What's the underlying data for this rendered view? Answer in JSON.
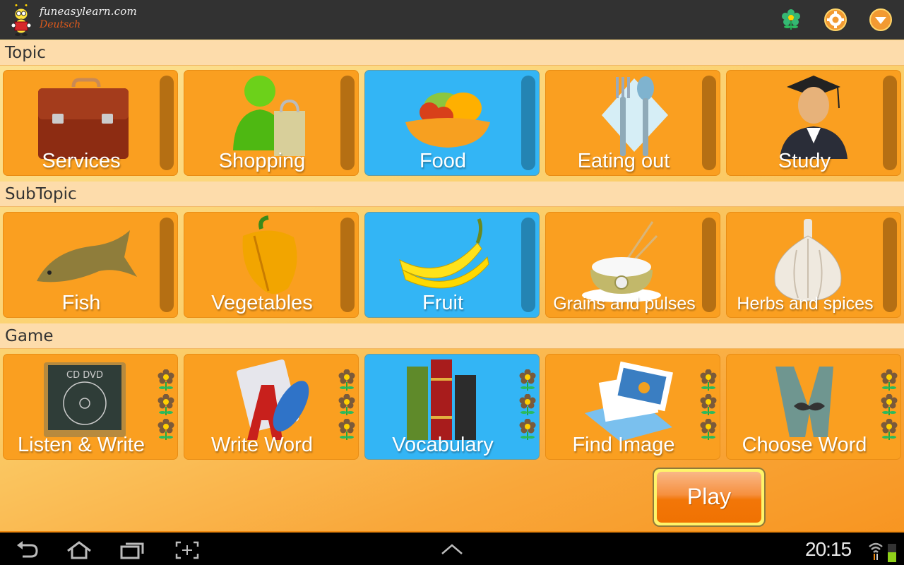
{
  "header": {
    "site": "funeasylearn.com",
    "language": "Deutsch",
    "icons": [
      "flower-icon",
      "settings-icon",
      "dropdown-menu-icon"
    ]
  },
  "sections": {
    "topic": {
      "title": "Topic",
      "items": [
        {
          "label": "Services",
          "icon": "briefcase-icon",
          "selected": false
        },
        {
          "label": "Shopping",
          "icon": "shopper-bag-icon",
          "selected": false
        },
        {
          "label": "Food",
          "icon": "fruit-tart-icon",
          "selected": true
        },
        {
          "label": "Eating out",
          "icon": "fork-spoon-icon",
          "selected": false
        },
        {
          "label": "Study",
          "icon": "graduate-icon",
          "selected": false
        }
      ]
    },
    "subtopic": {
      "title": "SubTopic",
      "items": [
        {
          "label": "Fish",
          "icon": "fish-icon",
          "selected": false
        },
        {
          "label": "Vegetables",
          "icon": "pepper-icon",
          "selected": false
        },
        {
          "label": "Fruit",
          "icon": "banana-icon",
          "selected": true
        },
        {
          "label": "Grains and pulses",
          "icon": "rice-bowl-icon",
          "selected": false
        },
        {
          "label": "Herbs and spices",
          "icon": "garlic-icon",
          "selected": false
        }
      ]
    },
    "game": {
      "title": "Game",
      "items": [
        {
          "label": "Listen & Write",
          "icon": "cd-dvd-icon",
          "selected": false,
          "flowers": 3
        },
        {
          "label": "Write Word",
          "icon": "write-word-icon",
          "selected": false,
          "flowers": 3
        },
        {
          "label": "Vocabulary",
          "icon": "books-icon",
          "selected": true,
          "flowers": 3
        },
        {
          "label": "Find Image",
          "icon": "photos-icon",
          "selected": false,
          "flowers": 3
        },
        {
          "label": "Choose Word",
          "icon": "letter-w-icon",
          "selected": false,
          "flowers": 3
        }
      ]
    }
  },
  "play_button": {
    "label": "Play"
  },
  "colors": {
    "tile": "#fa9f20",
    "tile_selected": "#33b5f5",
    "header_bg": "#fddcab",
    "actionbar": "#323232"
  },
  "system_bar": {
    "time": "20:15",
    "nav_icons": [
      "back-icon",
      "home-icon",
      "recent-apps-icon",
      "screenshot-icon",
      "expand-up-icon"
    ]
  }
}
